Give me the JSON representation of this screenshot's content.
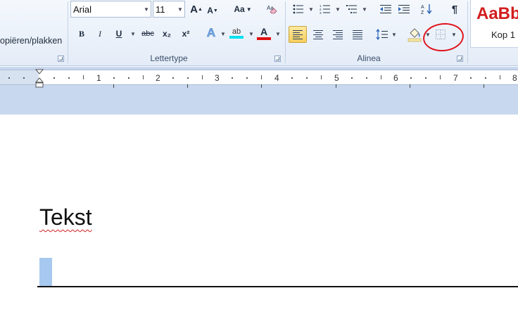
{
  "clipboard": {
    "paste_label": "opiëren/plakken"
  },
  "font": {
    "group_label": "Lettertype",
    "font_name": "Arial",
    "font_size": "11",
    "grow_label": "A",
    "shrink_label": "A",
    "case_label": "Aa",
    "bold": "B",
    "italic": "I",
    "underline": "U",
    "strike": "abc",
    "subscript": "x₂",
    "superscript": "x²",
    "effects": "A",
    "highlight": "ab",
    "font_color": "A",
    "highlight_color": "#00e0f0",
    "font_color_value": "#e01010"
  },
  "paragraph": {
    "group_label": "Alinea",
    "pilcrow": "¶"
  },
  "styles": {
    "preview": "AaBb",
    "name": "Kop 1",
    "preview_color": "#d21d1d"
  },
  "ruler": {
    "numbers": [
      "1",
      "2",
      "3",
      "4",
      "5",
      "6",
      "7",
      "8"
    ]
  },
  "document": {
    "text": "Tekst"
  }
}
